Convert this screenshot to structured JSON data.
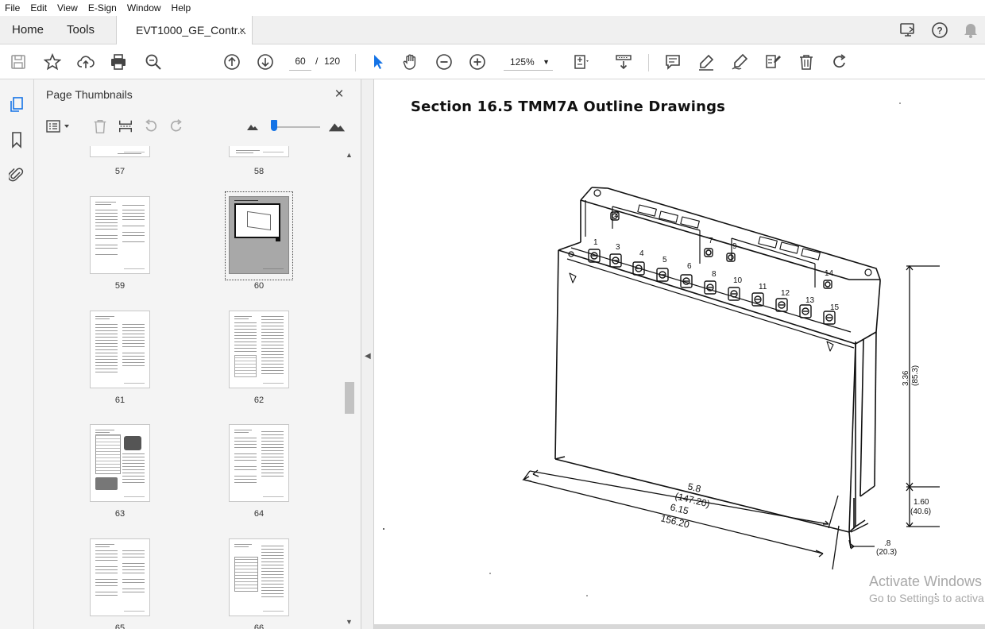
{
  "menu": {
    "items": [
      "File",
      "Edit",
      "View",
      "E-Sign",
      "Window",
      "Help"
    ]
  },
  "tabs": {
    "home": "Home",
    "tools": "Tools",
    "document": "EVT1000_GE_Contr...",
    "close": "×"
  },
  "toolbar": {
    "current_page": "60",
    "page_separator": "/",
    "total_pages": "120",
    "zoom": "125%"
  },
  "thumbnails_panel": {
    "title": "Page Thumbnails",
    "close": "×",
    "pages": [
      "57",
      "58",
      "59",
      "60",
      "61",
      "62",
      "63",
      "64",
      "65",
      "66"
    ],
    "selected_page": "60"
  },
  "document": {
    "section_title": "Section 16.5  TMM7A  Outline Drawings",
    "terminal_numbers": [
      "1",
      "2",
      "3",
      "4",
      "5",
      "6",
      "7",
      "8",
      "9",
      "10",
      "11",
      "12",
      "13",
      "14",
      "15"
    ],
    "dimensions": {
      "length_in": "5.8",
      "length_mm": "(147.20)",
      "overall_length_in": "6.15",
      "overall_length_mm": "156.20",
      "height_in": "3.36",
      "height_mm": "(85.3)",
      "base_in": "1.60",
      "base_mm": "(40.6)",
      "flange_in": ".8",
      "flange_mm": "(20.3)"
    }
  },
  "watermark": {
    "line1": "Activate Windows",
    "line2": "Go to Settings to activa"
  },
  "colors": {
    "accent": "#1473e6",
    "panel_bg": "#f4f4f4",
    "selected_thumb": "#a8a8a8"
  },
  "icons": {
    "toolbar": [
      "save-icon",
      "star-icon",
      "cloud-upload-icon",
      "print-icon",
      "search-icon",
      "page-up-icon",
      "page-down-icon",
      "select-arrow-icon",
      "hand-icon",
      "zoom-out-icon",
      "zoom-in-icon",
      "fit-page-icon",
      "scroll-mode-icon",
      "comment-icon",
      "highlight-icon",
      "draw-icon",
      "stamp-icon",
      "delete-icon",
      "rotate-icon"
    ]
  }
}
